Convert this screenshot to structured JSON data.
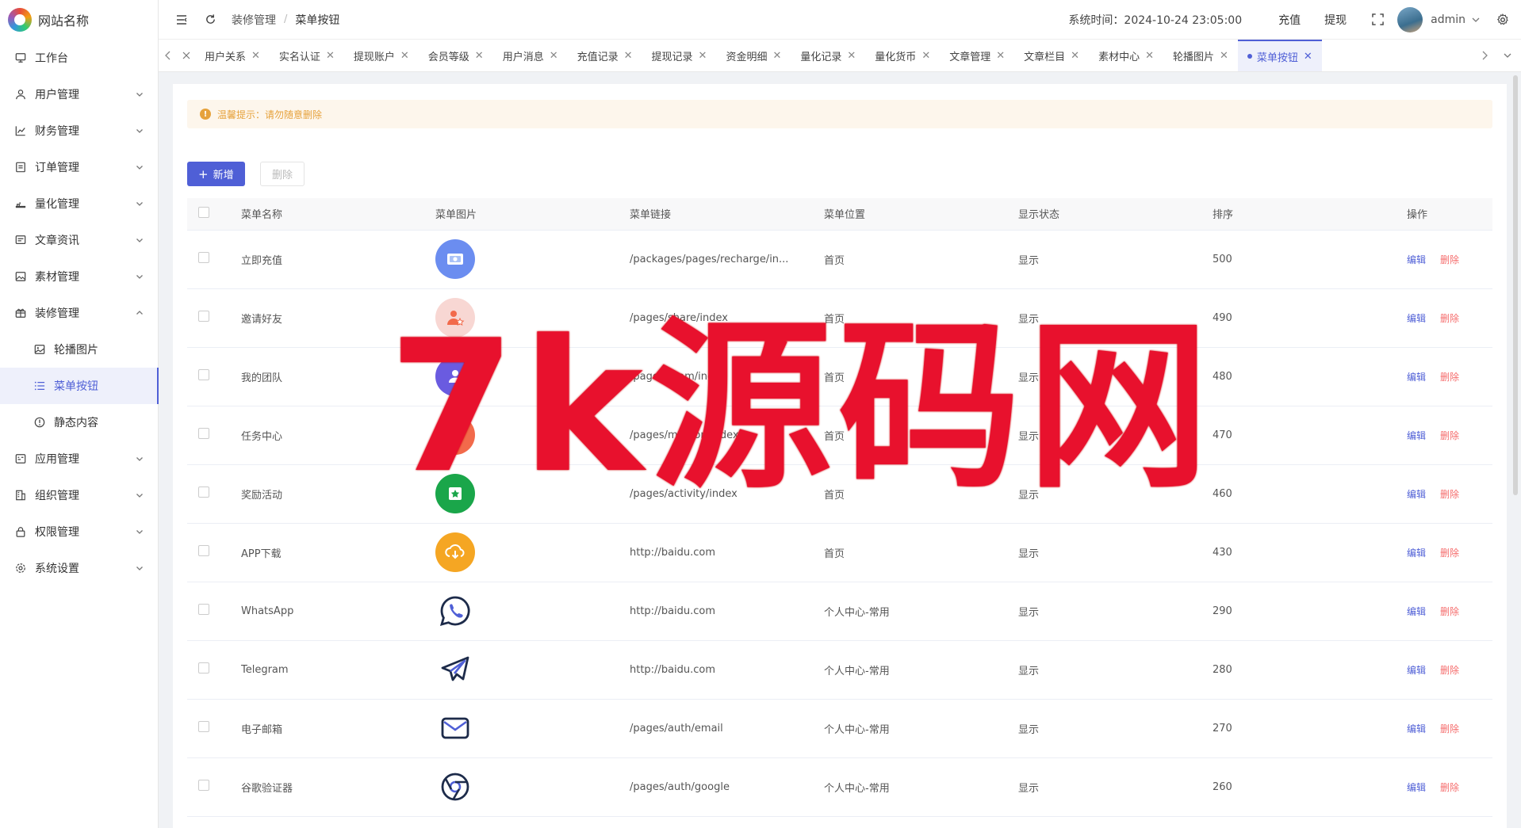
{
  "brand": {
    "name": "网站名称"
  },
  "sidebar": {
    "items": [
      {
        "label": "工作台",
        "icon": "monitor-icon"
      },
      {
        "label": "用户管理",
        "icon": "user-icon",
        "expandable": true
      },
      {
        "label": "财务管理",
        "icon": "chart-icon",
        "expandable": true
      },
      {
        "label": "订单管理",
        "icon": "list-icon",
        "expandable": true
      },
      {
        "label": "量化管理",
        "icon": "tool-icon",
        "expandable": true
      },
      {
        "label": "文章资讯",
        "icon": "article-icon",
        "expandable": true
      },
      {
        "label": "素材管理",
        "icon": "image-icon",
        "expandable": true
      },
      {
        "label": "装修管理",
        "icon": "gift-icon",
        "expanded": true
      },
      {
        "label": "轮播图片",
        "icon": "picture-icon",
        "sub": true
      },
      {
        "label": "菜单按钮",
        "icon": "menu-list-icon",
        "sub": true,
        "active": true
      },
      {
        "label": "静态内容",
        "icon": "info-icon",
        "sub": true
      },
      {
        "label": "应用管理",
        "icon": "app-icon",
        "expandable": true
      },
      {
        "label": "组织管理",
        "icon": "org-icon",
        "expandable": true
      },
      {
        "label": "权限管理",
        "icon": "lock-icon",
        "expandable": true
      },
      {
        "label": "系统设置",
        "icon": "gear-icon",
        "expandable": true
      }
    ]
  },
  "header": {
    "breadcrumb": [
      "装修管理",
      "菜单按钮"
    ],
    "system_time": "系统时间：2024-10-24 23:05:00",
    "recharge": "充值",
    "withdraw": "提现",
    "user": "admin"
  },
  "tabs": [
    "用户关系",
    "实名认证",
    "提现账户",
    "会员等级",
    "用户消息",
    "充值记录",
    "提现记录",
    "资金明细",
    "量化记录",
    "量化货币",
    "文章管理",
    "文章栏目",
    "素材中心",
    "轮播图片",
    "菜单按钮"
  ],
  "active_tab": "菜单按钮",
  "notice": "温馨提示：请勿随意删除",
  "toolbar": {
    "add_label": "新增",
    "delete_label": "删除"
  },
  "table": {
    "columns": [
      "菜单名称",
      "菜单图片",
      "菜单链接",
      "菜单位置",
      "显示状态",
      "排序",
      "操作"
    ],
    "rows": [
      {
        "name": "立即充值",
        "link": "/packages/pages/recharge/in...",
        "position": "首页",
        "status": "显示",
        "sort": "500",
        "icon": "recharge-icon",
        "color": "#6b8df0"
      },
      {
        "name": "邀请好友",
        "link": "/pages/share/index",
        "position": "首页",
        "status": "显示",
        "sort": "490",
        "icon": "invite-icon",
        "color": "#f8d7d3"
      },
      {
        "name": "我的团队",
        "link": "/pages/team/index",
        "position": "首页",
        "status": "显示",
        "sort": "480",
        "icon": "team-icon",
        "color": "#6a5be0"
      },
      {
        "name": "任务中心",
        "link": "/pages/mission/index",
        "position": "首页",
        "status": "显示",
        "sort": "470",
        "icon": "task-icon",
        "color": "#f26a4b"
      },
      {
        "name": "奖励活动",
        "link": "/pages/activity/index",
        "position": "首页",
        "status": "显示",
        "sort": "460",
        "icon": "reward-icon",
        "color": "#1aa64a"
      },
      {
        "name": "APP下载",
        "link": "http://baidu.com",
        "position": "首页",
        "status": "显示",
        "sort": "430",
        "icon": "cloud-download-icon",
        "color": "#f5a623"
      },
      {
        "name": "WhatsApp",
        "link": "http://baidu.com",
        "position": "个人中心-常用",
        "status": "显示",
        "sort": "290",
        "icon": "whatsapp-icon",
        "color": "#ffffff"
      },
      {
        "name": "Telegram",
        "link": "http://baidu.com",
        "position": "个人中心-常用",
        "status": "显示",
        "sort": "280",
        "icon": "telegram-icon",
        "color": "#ffffff"
      },
      {
        "name": "电子邮箱",
        "link": "/pages/auth/email",
        "position": "个人中心-常用",
        "status": "显示",
        "sort": "270",
        "icon": "email-icon",
        "color": "#ffffff"
      },
      {
        "name": "谷歌验证器",
        "link": "/pages/auth/google",
        "position": "个人中心-常用",
        "status": "显示",
        "sort": "260",
        "icon": "google-auth-icon",
        "color": "#ffffff"
      }
    ],
    "edit_label": "编辑",
    "delete_label": "删除"
  },
  "watermark": "7k源码网",
  "colors": {
    "accent": "#4f5fd6",
    "danger": "#f56c6c",
    "warning": "#e6a23c",
    "watermark": "#e8112d"
  }
}
